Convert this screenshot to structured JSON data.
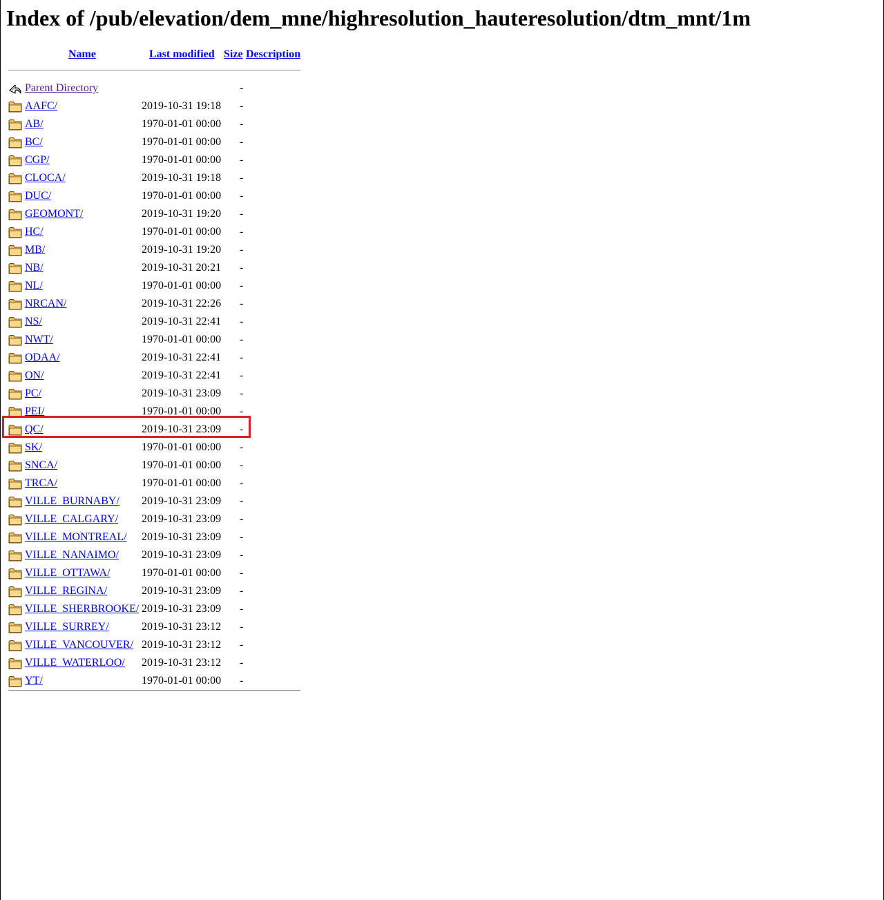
{
  "page": {
    "title": "Index of /pub/elevation/dem_mne/highresolution_hauteresolution/dtm_mnt/1m"
  },
  "columns": {
    "name": "Name",
    "last_modified": "Last modified",
    "size": "Size",
    "description": "Description"
  },
  "parent": {
    "label": "Parent Directory",
    "size": "-",
    "icon": "back-arrow-icon"
  },
  "folder_icon": "folder-icon",
  "highlight_color": "#e02020",
  "highlighted_entry": "QC/",
  "entries": [
    {
      "name": "AAFC/",
      "date": "2019-10-31 19:18",
      "size": "-"
    },
    {
      "name": "AB/",
      "date": "1970-01-01 00:00",
      "size": "-"
    },
    {
      "name": "BC/",
      "date": "1970-01-01 00:00",
      "size": "-"
    },
    {
      "name": "CGP/",
      "date": "1970-01-01 00:00",
      "size": "-"
    },
    {
      "name": "CLOCA/",
      "date": "2019-10-31 19:18",
      "size": "-"
    },
    {
      "name": "DUC/",
      "date": "1970-01-01 00:00",
      "size": "-"
    },
    {
      "name": "GEOMONT/",
      "date": "2019-10-31 19:20",
      "size": "-"
    },
    {
      "name": "HC/",
      "date": "1970-01-01 00:00",
      "size": "-"
    },
    {
      "name": "MB/",
      "date": "2019-10-31 19:20",
      "size": "-"
    },
    {
      "name": "NB/",
      "date": "2019-10-31 20:21",
      "size": "-"
    },
    {
      "name": "NL/",
      "date": "1970-01-01 00:00",
      "size": "-"
    },
    {
      "name": "NRCAN/",
      "date": "2019-10-31 22:26",
      "size": "-"
    },
    {
      "name": "NS/",
      "date": "2019-10-31 22:41",
      "size": "-"
    },
    {
      "name": "NWT/",
      "date": "1970-01-01 00:00",
      "size": "-"
    },
    {
      "name": "ODAA/",
      "date": "2019-10-31 22:41",
      "size": "-"
    },
    {
      "name": "ON/",
      "date": "2019-10-31 22:41",
      "size": "-"
    },
    {
      "name": "PC/",
      "date": "2019-10-31 23:09",
      "size": "-"
    },
    {
      "name": "PEI/",
      "date": "1970-01-01 00:00",
      "size": "-"
    },
    {
      "name": "QC/",
      "date": "2019-10-31 23:09",
      "size": "-"
    },
    {
      "name": "SK/",
      "date": "1970-01-01 00:00",
      "size": "-"
    },
    {
      "name": "SNCA/",
      "date": "1970-01-01 00:00",
      "size": "-"
    },
    {
      "name": "TRCA/",
      "date": "1970-01-01 00:00",
      "size": "-"
    },
    {
      "name": "VILLE_BURNABY/",
      "date": "2019-10-31 23:09",
      "size": "-"
    },
    {
      "name": "VILLE_CALGARY/",
      "date": "2019-10-31 23:09",
      "size": "-"
    },
    {
      "name": "VILLE_MONTREAL/",
      "date": "2019-10-31 23:09",
      "size": "-"
    },
    {
      "name": "VILLE_NANAIMO/",
      "date": "2019-10-31 23:09",
      "size": "-"
    },
    {
      "name": "VILLE_OTTAWA/",
      "date": "1970-01-01 00:00",
      "size": "-"
    },
    {
      "name": "VILLE_REGINA/",
      "date": "2019-10-31 23:09",
      "size": "-"
    },
    {
      "name": "VILLE_SHERBROOKE/",
      "date": "2019-10-31 23:09",
      "size": "-"
    },
    {
      "name": "VILLE_SURREY/",
      "date": "2019-10-31 23:12",
      "size": "-"
    },
    {
      "name": "VILLE_VANCOUVER/",
      "date": "2019-10-31 23:12",
      "size": "-"
    },
    {
      "name": "VILLE_WATERLOO/",
      "date": "2019-10-31 23:12",
      "size": "-"
    },
    {
      "name": "YT/",
      "date": "1970-01-01 00:00",
      "size": "-"
    }
  ]
}
